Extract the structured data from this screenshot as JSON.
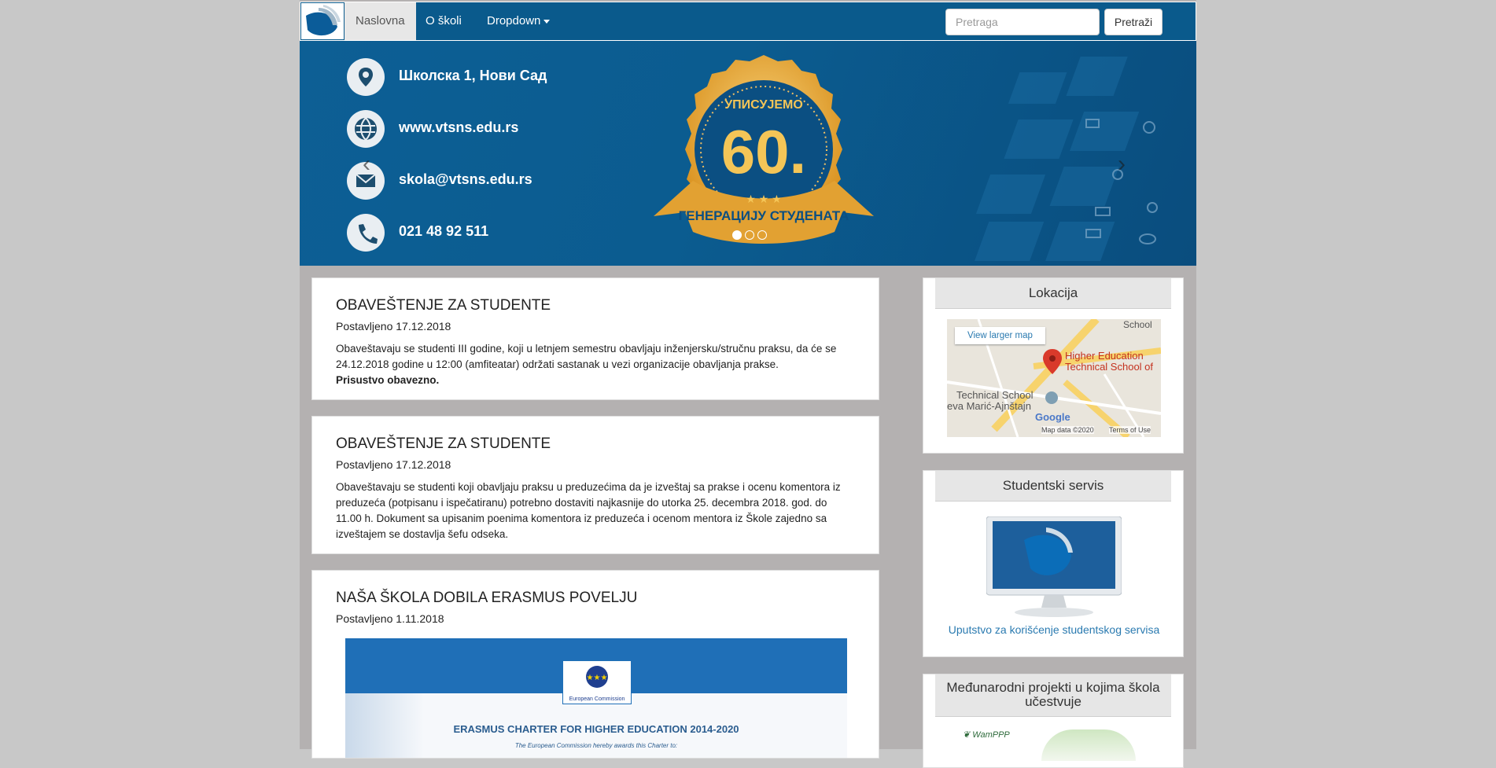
{
  "nav": {
    "items": [
      "Naslovna",
      "O školi",
      "Dropdown"
    ],
    "search_placeholder": "Pretraga",
    "search_button": "Pretraži"
  },
  "carousel": {
    "address": "Школска 1, Нови Сад",
    "website": "www.vtsns.edu.rs",
    "email": "skola@vtsns.edu.rs",
    "phone": "021 48 92 511",
    "badge_top": "УПИСУЈЕМО",
    "badge_number": "60.",
    "badge_ribbon": "ГЕНЕРАЦИЈУ СТУДЕНАТА"
  },
  "posts": [
    {
      "title": "OBAVEŠTENJE ZA STUDENTE",
      "date": "Postavljeno 17.12.2018",
      "body": "Obaveštavaju se studenti III godine, koji u letnjem semestru obavljaju inženjersku/stručnu praksu, da će se 24.12.2018 godine u 12:00 (amfiteatar) održati sastanak u vezi organizacije obavljanja prakse.",
      "bold": "Prisustvo obavezno."
    },
    {
      "title": "OBAVEŠTENJE ZA STUDENTE",
      "date": "Postavljeno 17.12.2018",
      "body": "Obaveštavaju se studenti koji obavljaju praksu u preduzećima da je izveštaj sa prakse i ocenu komentora iz preduzeća (potpisanu i ispečatiranu) potrebno dostaviti najkasnije do utorka 25. decembra 2018. god. do 11.00 h. Dokument sa upisanim poenima komentora iz preduzeća i ocenom mentora iz Škole zajedno sa izveštajem se dostavlja šefu odseka."
    },
    {
      "title": "NAŠA ŠKOLA DOBILA ERASMUS POVELJU",
      "date": "Postavljeno 1.11.2018",
      "image_caption": "ERASMUS CHARTER FOR HIGHER EDUCATION 2014-2020",
      "image_sub": "The European Commission hereby awards this Charter to:",
      "image_ec": "European Commission"
    }
  ],
  "sidebar": {
    "location_title": "Lokacija",
    "map_link": "View larger map",
    "map_label1": "Higher Education",
    "map_label2": "Technical School of",
    "map_label3": "Technical School",
    "map_label4": "eva Marić-Ajnštajn",
    "map_school": "School",
    "map_google": "Google",
    "map_data": "Map data ©2020",
    "map_terms": "Terms of Use",
    "service_title": "Studentski servis",
    "service_link": "Uputstvo za korišćenje studentskog servisa",
    "projects_title": "Međunarodni projekti u kojima škola učestvuje",
    "projects_logo": "WamPPP"
  }
}
